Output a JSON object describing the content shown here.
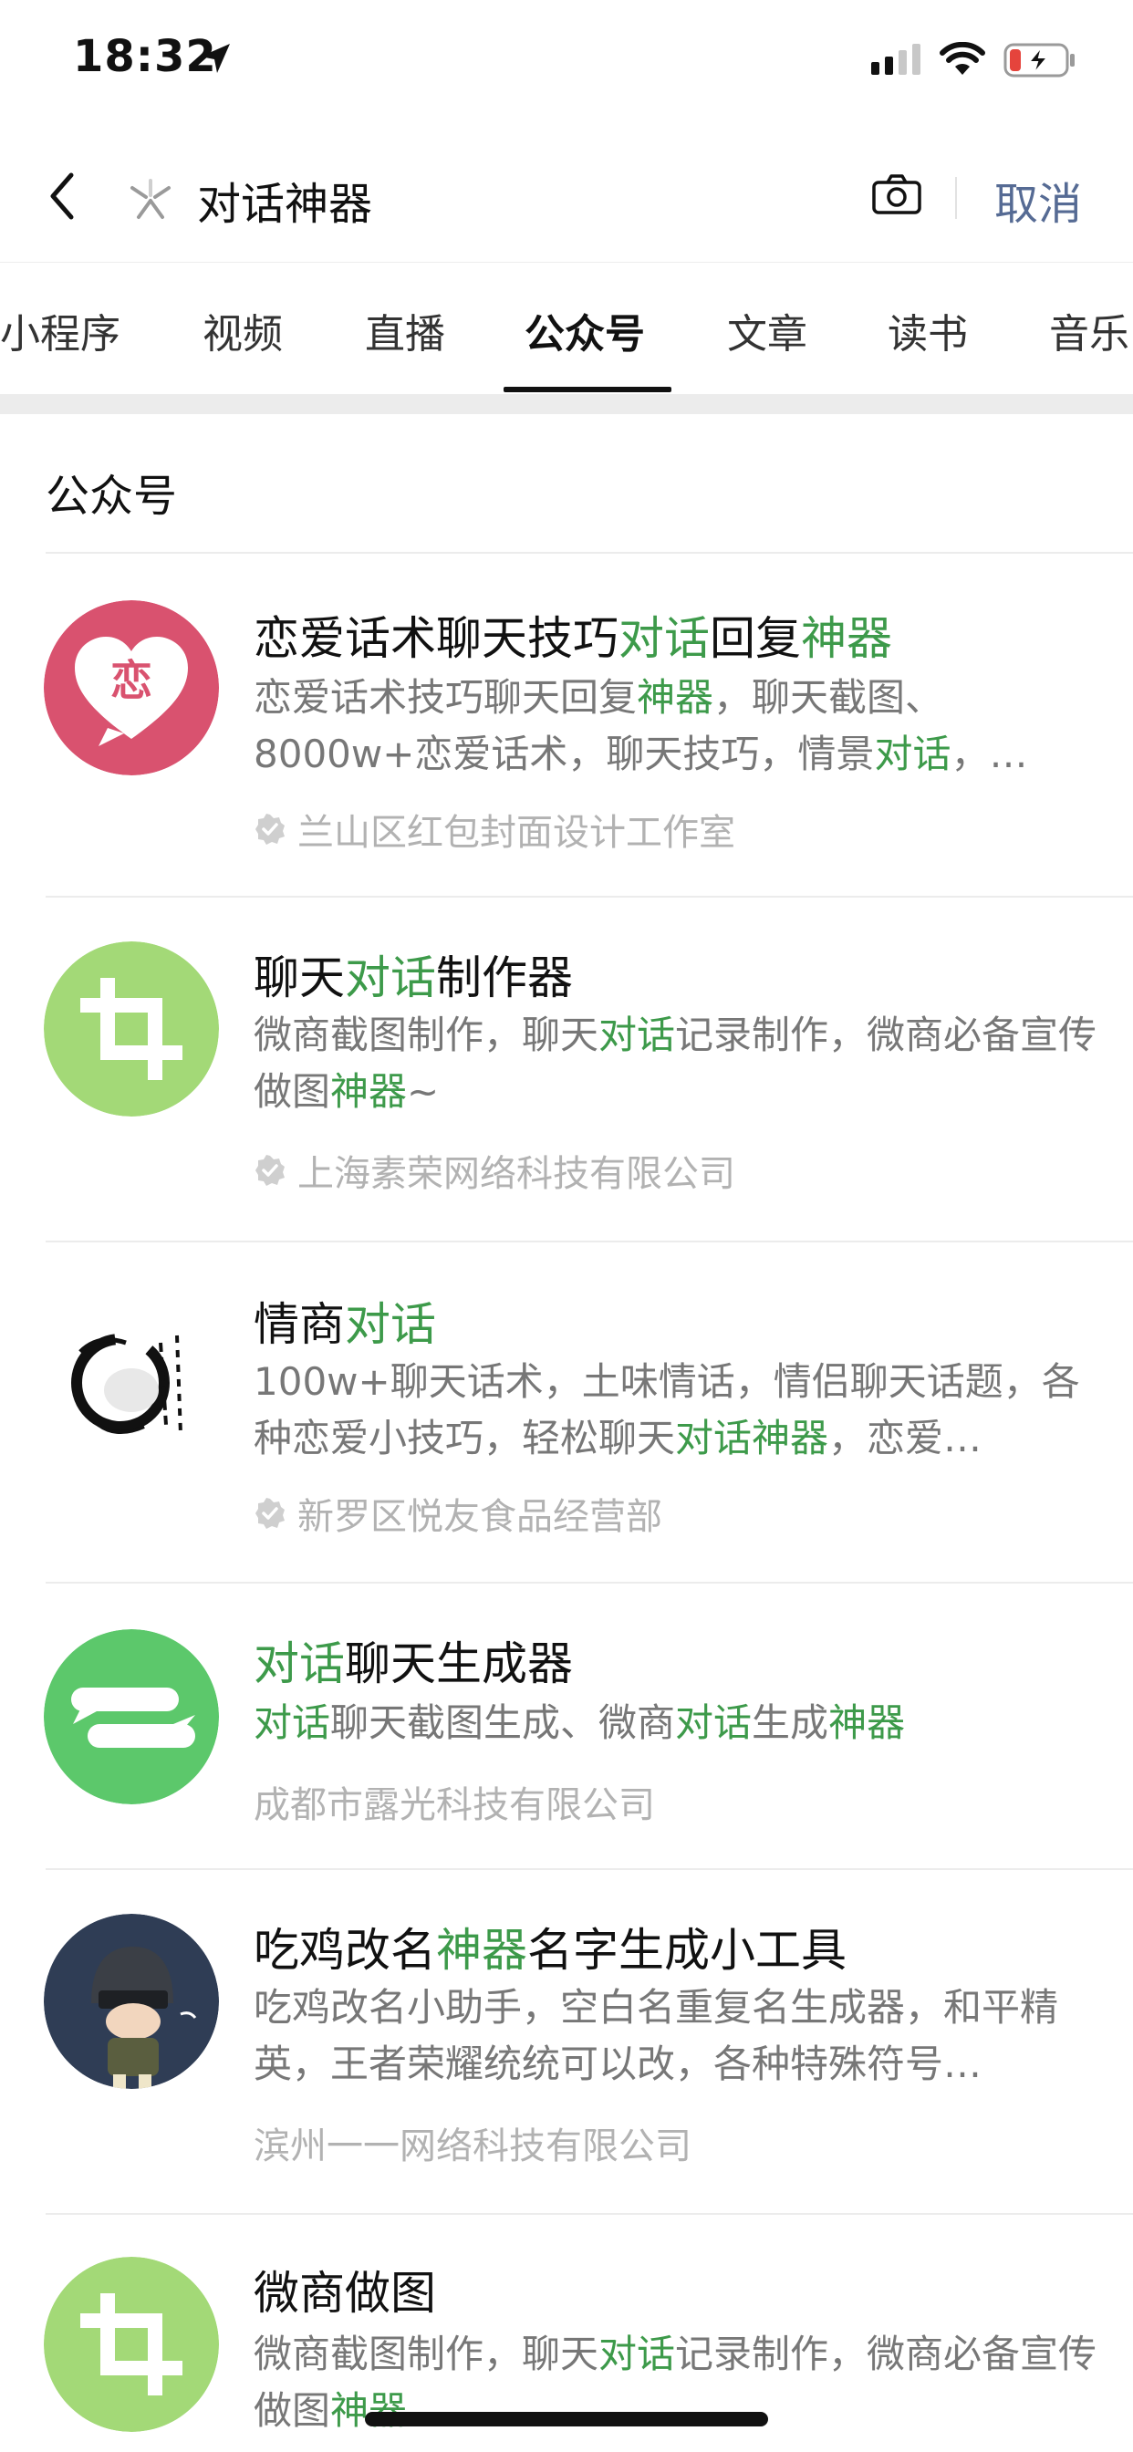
{
  "status_bar": {
    "time": "18:32"
  },
  "search": {
    "query": "对话神器",
    "cancel_label": "取消"
  },
  "tabs": [
    {
      "label": "小程序"
    },
    {
      "label": "视频"
    },
    {
      "label": "直播"
    },
    {
      "label": "公众号"
    },
    {
      "label": "文章"
    },
    {
      "label": "读书"
    },
    {
      "label": "音乐"
    }
  ],
  "active_tab": "公众号",
  "section_title": "公众号",
  "highlight_color": "#3d9a4a",
  "results": [
    {
      "title": [
        {
          "t": "恋爱话术聊天技巧"
        },
        {
          "t": "对话",
          "hl": true
        },
        {
          "t": "回复"
        },
        {
          "t": "神器",
          "hl": true
        }
      ],
      "avatar_text": "恋",
      "desc": [
        {
          "t": "恋爱话术技巧聊天回复"
        },
        {
          "t": "神器",
          "hl": true
        },
        {
          "t": "，聊天截图、8000w+恋爱话术，聊天技巧，情景"
        },
        {
          "t": "对话",
          "hl": true
        },
        {
          "t": "，…"
        }
      ],
      "source": "兰山区红包封面设计工作室",
      "verified": true
    },
    {
      "title": [
        {
          "t": "聊天"
        },
        {
          "t": "对话",
          "hl": true
        },
        {
          "t": "制作器"
        }
      ],
      "desc": [
        {
          "t": "微商截图制作，聊天"
        },
        {
          "t": "对话",
          "hl": true
        },
        {
          "t": "记录制作，微商必备宣传做图"
        },
        {
          "t": "神器",
          "hl": true
        },
        {
          "t": "~"
        }
      ],
      "source": "上海素荣网络科技有限公司",
      "verified": true
    },
    {
      "title": [
        {
          "t": "情商"
        },
        {
          "t": "对话",
          "hl": true
        }
      ],
      "desc": [
        {
          "t": "100w+聊天话术，土味情话，情侣聊天话题，各种恋爱小技巧，轻松聊天"
        },
        {
          "t": "对话神器",
          "hl": true
        },
        {
          "t": "，恋爱…"
        }
      ],
      "source": "新罗区悦友食品经营部",
      "verified": true
    },
    {
      "title": [
        {
          "t": "对话",
          "hl": true
        },
        {
          "t": "聊天生成器"
        }
      ],
      "desc": [
        {
          "t": "对话",
          "hl": true
        },
        {
          "t": "聊天截图生成、微商"
        },
        {
          "t": "对话",
          "hl": true
        },
        {
          "t": "生成"
        },
        {
          "t": "神器",
          "hl": true
        }
      ],
      "source": "成都市露光科技有限公司",
      "verified": false
    },
    {
      "title": [
        {
          "t": "吃鸡改名"
        },
        {
          "t": "神器",
          "hl": true
        },
        {
          "t": "名字生成小工具"
        }
      ],
      "desc": [
        {
          "t": "吃鸡改名小助手，空白名重复名生成器，和平精英，王者荣耀统统可以改，各种特殊符号…"
        }
      ],
      "source": "滨州一一网络科技有限公司",
      "verified": false
    },
    {
      "title": [
        {
          "t": "微商做图"
        }
      ],
      "desc": [
        {
          "t": "微商截图制作，聊天"
        },
        {
          "t": "对话",
          "hl": true
        },
        {
          "t": "记录制作，微商必备宣传做图"
        },
        {
          "t": "神器",
          "hl": true
        }
      ],
      "source": "",
      "verified": false
    }
  ]
}
